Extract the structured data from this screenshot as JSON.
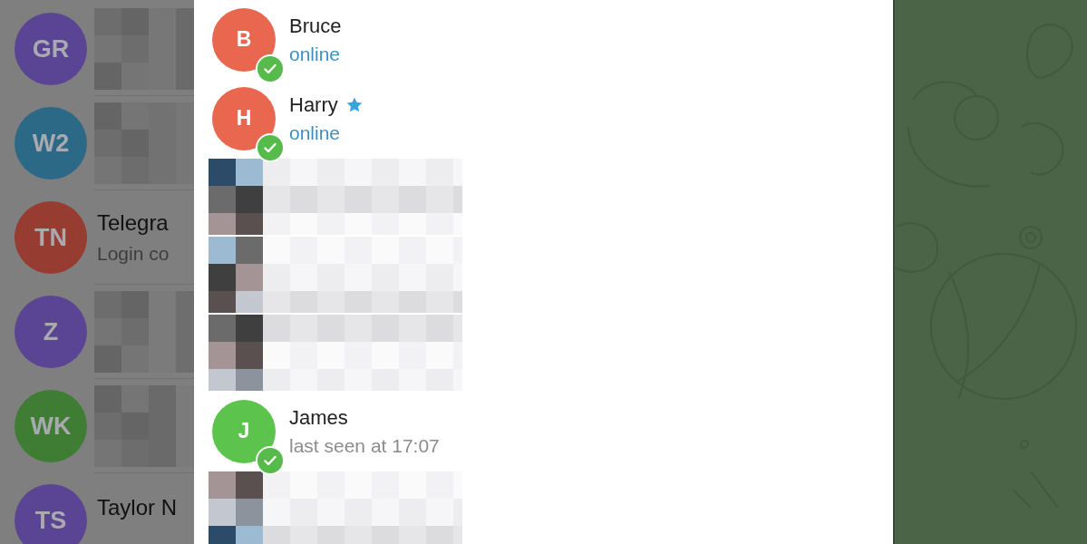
{
  "chat_list": {
    "chats": [
      {
        "kind": "redacted",
        "initials": "GR",
        "color": "#5a4494"
      },
      {
        "kind": "redacted",
        "initials": "W2",
        "color": "#2c6987"
      },
      {
        "kind": "chat",
        "initials": "TN",
        "color": "#963c30",
        "title": "Telegra",
        "preview": "Login co"
      },
      {
        "kind": "redacted",
        "initials": "Z",
        "color": "#5a4494"
      },
      {
        "kind": "redacted",
        "initials": "WK",
        "color": "#3e7d33"
      },
      {
        "kind": "chat",
        "initials": "TS",
        "color": "#5a4494",
        "title": "Taylor N"
      }
    ]
  },
  "contacts_dialog": {
    "contacts": [
      {
        "kind": "contact",
        "initials": "B",
        "color": "#e9664f",
        "name": "Bruce",
        "status": "online",
        "online": true,
        "starred": false,
        "selected": true
      },
      {
        "kind": "contact",
        "initials": "H",
        "color": "#e9664f",
        "name": "Harry",
        "status": "online",
        "online": true,
        "starred": true,
        "selected": true
      },
      {
        "kind": "redacted"
      },
      {
        "kind": "redacted"
      },
      {
        "kind": "redacted"
      },
      {
        "kind": "contact",
        "initials": "J",
        "color": "#5cc44c",
        "name": "James",
        "status": "last seen at 17:07",
        "online": false,
        "starred": false,
        "selected": true
      },
      {
        "kind": "redacted"
      }
    ]
  }
}
